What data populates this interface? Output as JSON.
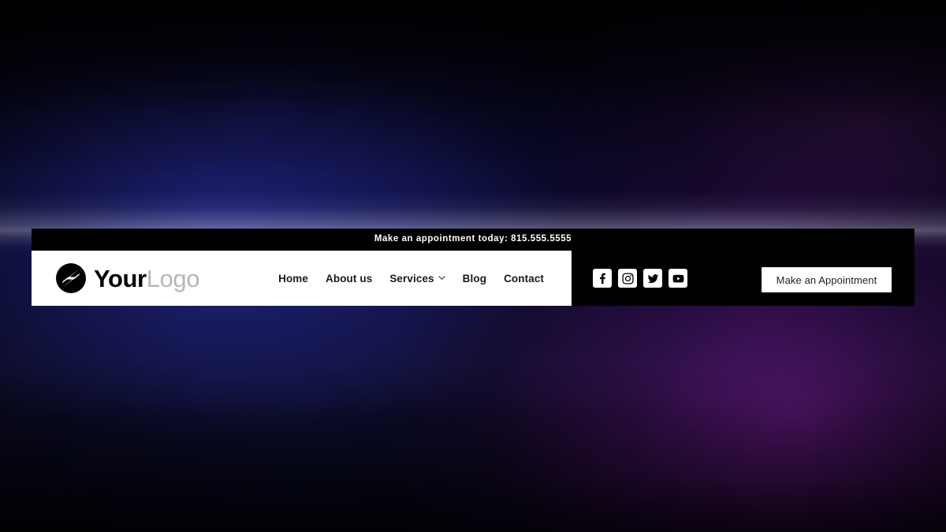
{
  "theme": {
    "header_bg": "#000000",
    "nav_bg": "#ffffff",
    "text_dark": "#1b1b1b",
    "logo_accent": "#b7b7b7",
    "bg_blue": "#222684",
    "bg_purple": "#601678"
  },
  "announcement": {
    "text": "Make an appointment today: 815.555.5555"
  },
  "logo": {
    "mark": "circle-slash-logo-icon",
    "primary": "Your",
    "secondary": "Logo"
  },
  "nav": {
    "items": [
      {
        "label": "Home",
        "has_dropdown": false
      },
      {
        "label": "About us",
        "has_dropdown": false
      },
      {
        "label": "Services",
        "has_dropdown": true,
        "dropdown_icon": "chevron-down-icon"
      },
      {
        "label": "Blog",
        "has_dropdown": false
      },
      {
        "label": "Contact",
        "has_dropdown": false
      }
    ]
  },
  "social": {
    "items": [
      {
        "name": "Facebook",
        "icon": "facebook-icon"
      },
      {
        "name": "Instagram",
        "icon": "instagram-icon"
      },
      {
        "name": "Twitter",
        "icon": "twitter-icon"
      },
      {
        "name": "YouTube",
        "icon": "youtube-icon"
      }
    ]
  },
  "cta": {
    "label": "Make an Appointment"
  }
}
